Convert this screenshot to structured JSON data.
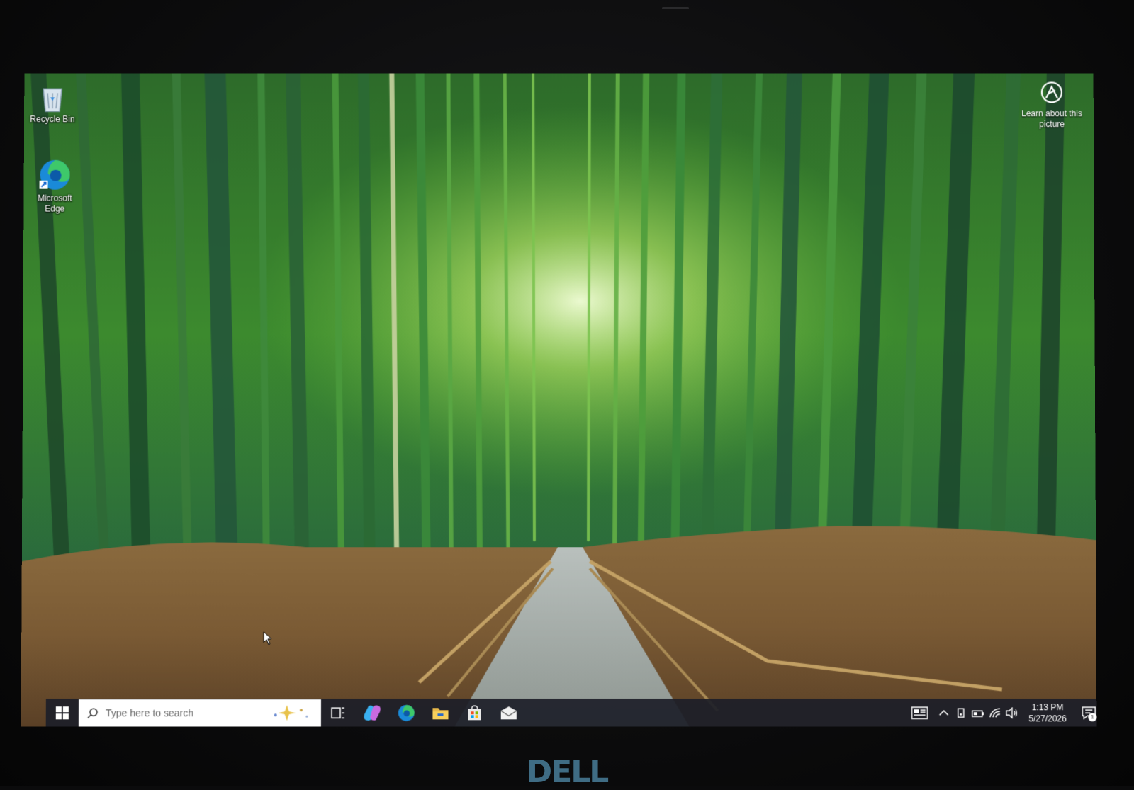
{
  "desktop": {
    "icons": [
      {
        "label": "Recycle Bin",
        "icon": "recycle-bin-icon"
      },
      {
        "label": "Microsoft Edge",
        "icon": "edge-icon"
      }
    ],
    "spotlight": {
      "label": "Learn about this picture",
      "icon": "spotlight-icon"
    }
  },
  "taskbar": {
    "search_placeholder": "Type here to search",
    "pinned": [
      {
        "name": "task-view",
        "icon": "task-view-icon"
      },
      {
        "name": "copilot",
        "icon": "copilot-icon"
      },
      {
        "name": "edge",
        "icon": "edge-icon"
      },
      {
        "name": "file-explorer",
        "icon": "folder-icon"
      },
      {
        "name": "microsoft-store",
        "icon": "store-icon"
      },
      {
        "name": "mail",
        "icon": "mail-icon"
      }
    ],
    "tray": {
      "time": "1:13 PM",
      "date": "5/27/2026",
      "notification_count": "1"
    }
  },
  "bezel": {
    "brand": "DELL"
  },
  "colors": {
    "taskbar": "#1c1e28",
    "accent": "#3f6c84"
  }
}
